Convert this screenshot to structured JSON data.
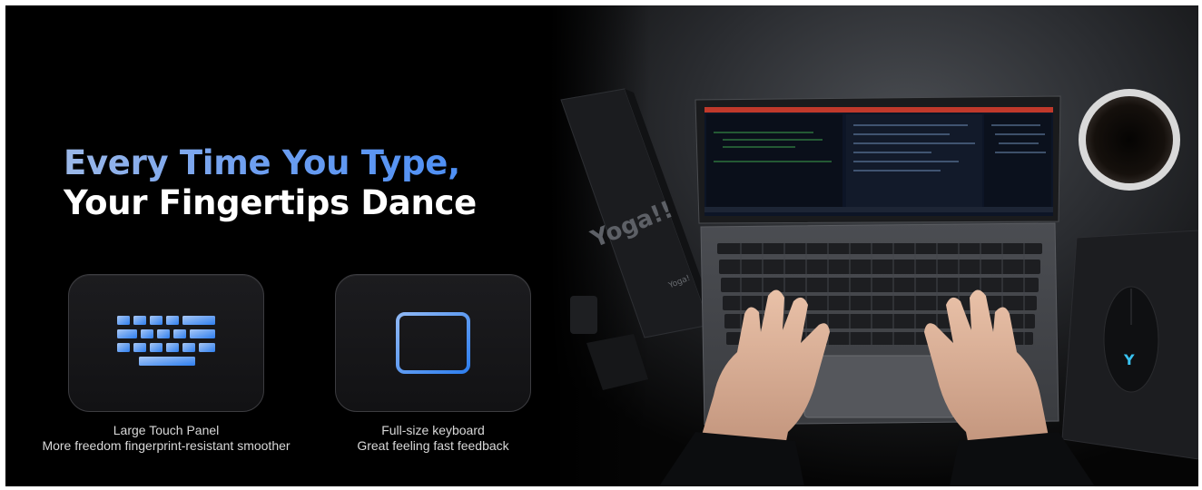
{
  "headline": {
    "line1": "Every Time You Type,",
    "line2": "Your Fingertips Dance"
  },
  "features": [
    {
      "icon": "keyboard-icon",
      "title": "Large Touch Panel",
      "description": "More freedom fingerprint-resistant smoother"
    },
    {
      "icon": "touchpad-icon",
      "title": "Full-size keyboard",
      "description": "Great feeling fast feedback"
    }
  ],
  "photo": {
    "box_text": "Yoga!!",
    "box_small_text": "Yoga!",
    "mouse_logo": "Y"
  },
  "colors": {
    "background": "#000000",
    "accent_blue": "#4b8ef5",
    "icon_blue": "#4a90f0",
    "caption_text": "#d8d8d8"
  }
}
